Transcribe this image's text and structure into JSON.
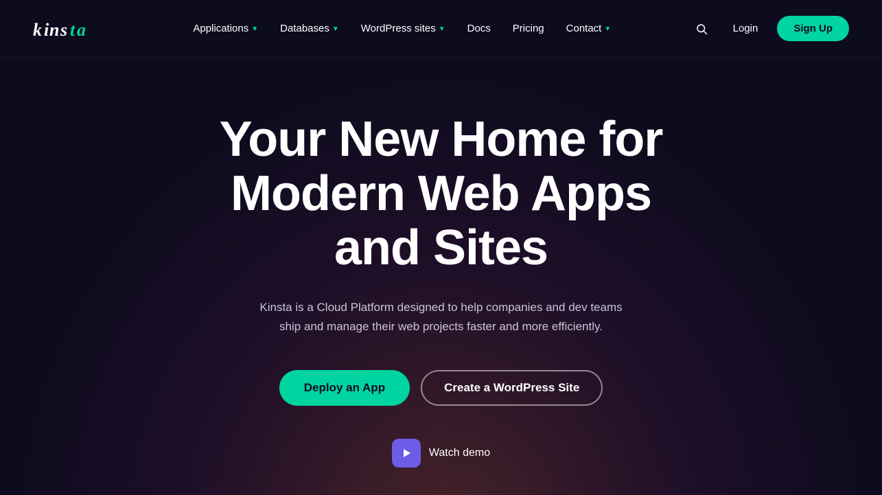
{
  "brand": {
    "name": "kinsta",
    "logo_display": "Kinsta"
  },
  "navbar": {
    "links": [
      {
        "id": "applications",
        "label": "Applications",
        "has_dropdown": true
      },
      {
        "id": "databases",
        "label": "Databases",
        "has_dropdown": true
      },
      {
        "id": "wordpress-sites",
        "label": "WordPress sites",
        "has_dropdown": true
      },
      {
        "id": "docs",
        "label": "Docs",
        "has_dropdown": false
      },
      {
        "id": "pricing",
        "label": "Pricing",
        "has_dropdown": false
      },
      {
        "id": "contact",
        "label": "Contact",
        "has_dropdown": true
      }
    ],
    "login_label": "Login",
    "signup_label": "Sign Up",
    "search_aria": "Search"
  },
  "hero": {
    "title": "Your New Home for Modern Web Apps and Sites",
    "subtitle": "Kinsta is a Cloud Platform designed to help companies and dev teams ship and manage their web projects faster and more efficiently.",
    "btn_deploy": "Deploy an App",
    "btn_wordpress": "Create a WordPress Site",
    "watch_demo_label": "Watch demo"
  },
  "colors": {
    "accent": "#00d4a1",
    "bg_dark": "#0d0b1e",
    "play_bg": "#6c5ce7"
  }
}
